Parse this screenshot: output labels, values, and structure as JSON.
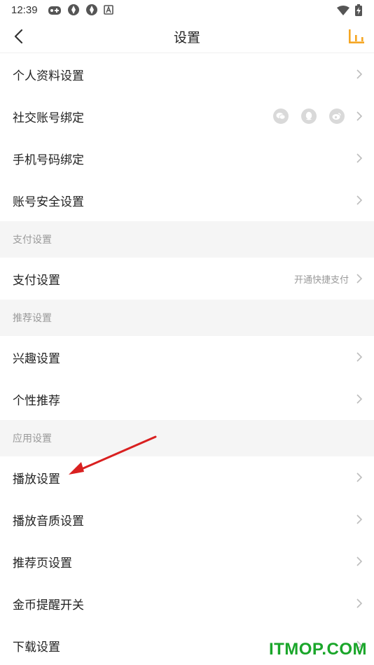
{
  "status_bar": {
    "time": "12:39",
    "icons": [
      "game-icon",
      "app-icon",
      "app-icon",
      "a-icon"
    ],
    "right_icons": [
      "wifi-icon",
      "battery-charging-icon"
    ]
  },
  "header": {
    "title": "设置",
    "back_icon": "chevron-left-icon",
    "right_icon": "bar-chart-icon",
    "accent_color": "#f5a623"
  },
  "rows": [
    {
      "label": "个人资料设置"
    },
    {
      "label": "社交账号绑定",
      "socials": [
        "wechat-icon",
        "qq-icon",
        "weibo-icon"
      ]
    },
    {
      "label": "手机号码绑定"
    },
    {
      "label": "账号安全设置"
    }
  ],
  "sections": [
    {
      "title": "支付设置",
      "rows": [
        {
          "label": "支付设置",
          "value": "开通快捷支付"
        }
      ]
    },
    {
      "title": "推荐设置",
      "rows": [
        {
          "label": "兴趣设置"
        },
        {
          "label": "个性推荐"
        }
      ]
    },
    {
      "title": "应用设置",
      "rows": [
        {
          "label": "播放设置"
        },
        {
          "label": "播放音质设置"
        },
        {
          "label": "推荐页设置"
        },
        {
          "label": "金币提醒开关"
        },
        {
          "label": "下载设置"
        }
      ]
    }
  ],
  "annotation": {
    "color": "#d92020",
    "target": "播放设置"
  },
  "watermark": {
    "text": "ITMOP.COM",
    "color": "#1aa62a"
  }
}
